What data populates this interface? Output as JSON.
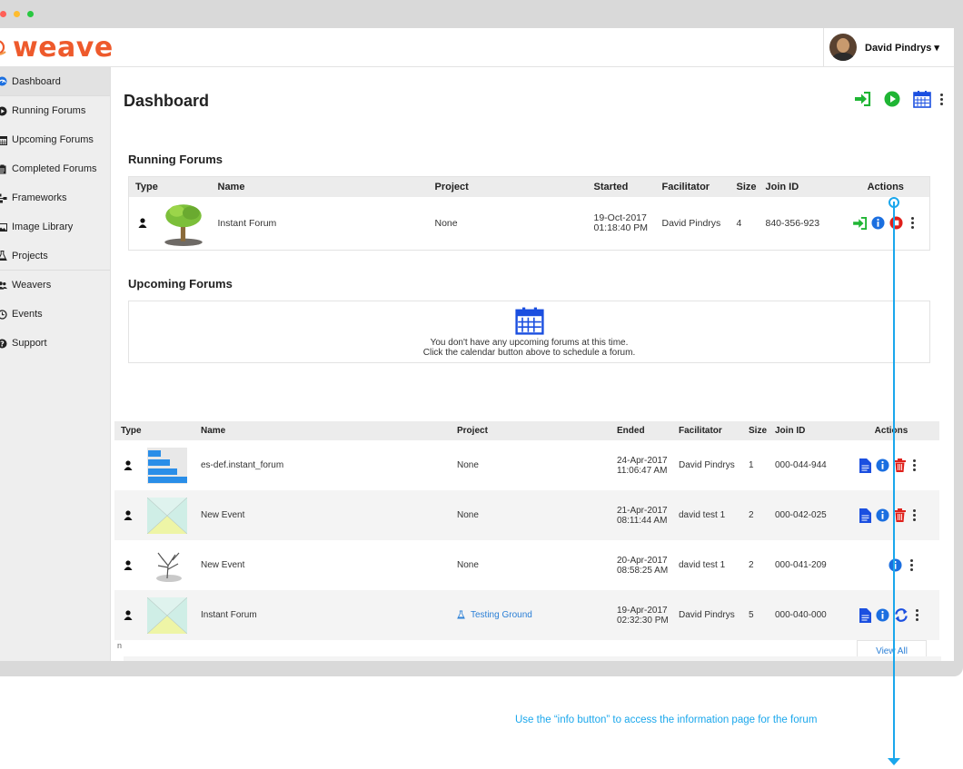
{
  "window_dots": [
    "#ff5f57",
    "#febc2e",
    "#28c840"
  ],
  "brand": {
    "logo_text": "weave",
    "color": "#ee5a2c"
  },
  "user": {
    "name": "David Pindrys ▾"
  },
  "sidebar": {
    "items": [
      {
        "label": "Dashboard",
        "icon": "dashboard-icon"
      },
      {
        "label": "Running Forums",
        "icon": "play-circle-icon"
      },
      {
        "label": "Upcoming Forums",
        "icon": "calendar-icon"
      },
      {
        "label": "Completed Forums",
        "icon": "clipboard-icon"
      },
      {
        "label": "Frameworks",
        "icon": "sitemap-icon"
      },
      {
        "label": "Image Library",
        "icon": "image-icon"
      },
      {
        "label": "Projects",
        "icon": "flask-icon"
      },
      {
        "label": "Weavers",
        "icon": "users-icon"
      },
      {
        "label": "Events",
        "icon": "clock-icon"
      },
      {
        "label": "Support",
        "icon": "question-circle-icon"
      }
    ]
  },
  "page": {
    "title": "Dashboard"
  },
  "running": {
    "title": "Running Forums",
    "headers": [
      "Type",
      "Name",
      "Project",
      "Started",
      "Facilitator",
      "Size",
      "Join ID",
      "Actions"
    ],
    "rows": [
      {
        "name": "Instant Forum",
        "project": "None",
        "date1": "19-Oct-2017",
        "date2": "01:18:40 PM",
        "facilitator": "David Pindrys",
        "size": "4",
        "join_id": "840-356-923"
      }
    ]
  },
  "upcoming": {
    "title": "Upcoming Forums",
    "empty_line1": "You don't have any upcoming forums at this time.",
    "empty_line2": "Click the calendar button above to schedule a forum."
  },
  "completed": {
    "headers": [
      "Type",
      "Name",
      "Project",
      "Ended",
      "Facilitator",
      "Size",
      "Join ID",
      "Actions"
    ],
    "rows": [
      {
        "name": "es-def.instant_forum",
        "project": "None",
        "date1": "24-Apr-2017",
        "date2": "11:06:47 AM",
        "facilitator": "David Pindrys",
        "size": "1",
        "join_id": "000-044-944"
      },
      {
        "name": "New Event",
        "project": "None",
        "date1": "21-Apr-2017",
        "date2": "08:11:44 AM",
        "facilitator": "david test 1",
        "size": "2",
        "join_id": "000-042-025"
      },
      {
        "name": "New Event",
        "project": "None",
        "date1": "20-Apr-2017",
        "date2": "08:58:25 AM",
        "facilitator": "david test 1",
        "size": "2",
        "join_id": "000-041-209"
      },
      {
        "name": "Instant Forum",
        "project": "Testing Ground",
        "date1": "19-Apr-2017",
        "date2": "02:32:30 PM",
        "facilitator": "David Pindrys",
        "size": "5",
        "join_id": "000-040-000"
      }
    ],
    "view_all": "View All",
    "stray_char": "n"
  },
  "callout": {
    "text": "Use the “info button” to access the information page for the forum"
  },
  "colors": {
    "green": "#1fb534",
    "blue": "#1b4fe0",
    "red": "#e0201b",
    "link": "#2a7fd6",
    "callout": "#1aa7ec"
  }
}
